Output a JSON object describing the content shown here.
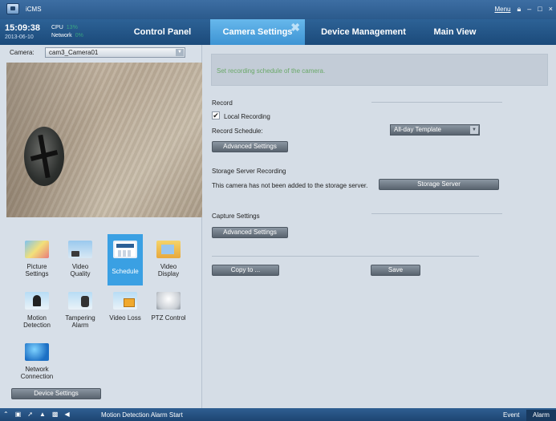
{
  "window": {
    "title": "iCMS",
    "menu_label": "Menu"
  },
  "header": {
    "time": "15:09:38",
    "date": "2013-06-10",
    "cpu_label": "CPU",
    "cpu_value": "13%",
    "network_label": "Network",
    "network_value": "0%"
  },
  "tabs": [
    {
      "label": "Control Panel"
    },
    {
      "label": "Camera Settings",
      "active": true
    },
    {
      "label": "Device Management"
    },
    {
      "label": "Main View"
    }
  ],
  "left": {
    "camera_label": "Camera:",
    "camera_value": "cam3_Camera01",
    "tiles": [
      {
        "label": "Picture Settings",
        "icon": "picture-settings-icon"
      },
      {
        "label": "Video Quality",
        "icon": "video-quality-icon"
      },
      {
        "label": "Schedule",
        "icon": "schedule-icon",
        "selected": true
      },
      {
        "label": "Video Display",
        "icon": "video-display-icon"
      },
      {
        "label": "Motion Detection",
        "icon": "motion-detection-icon"
      },
      {
        "label": "Tampering Alarm",
        "icon": "tampering-alarm-icon"
      },
      {
        "label": "Video Loss",
        "icon": "video-loss-icon"
      },
      {
        "label": "PTZ Control",
        "icon": "ptz-control-icon"
      },
      {
        "label": "Network Connection",
        "icon": "network-connection-icon"
      }
    ],
    "device_settings_label": "Device Settings"
  },
  "content": {
    "info": "Set recording schedule of the camera.",
    "record_title": "Record",
    "local_recording_label": "Local Recording",
    "local_recording_checked": true,
    "record_schedule_label": "Record Schedule:",
    "record_schedule_value": "All-day Template",
    "advanced_settings_label": "Advanced Settings",
    "storage_title": "Storage Server Recording",
    "storage_text": "This camera has not been added to the storage server.",
    "storage_button_label": "Storage Server",
    "capture_title": "Capture Settings",
    "capture_advanced_label": "Advanced Settings",
    "copy_to_label": "Copy to ...",
    "save_label": "Save"
  },
  "statusbar": {
    "alarm_text": "Motion Detection Alarm Start",
    "event_label": "Event",
    "alarm_label": "Alarm"
  },
  "colors": {
    "accent": "#3aa0e3",
    "titlebar": "#2b5a8c",
    "panel_bg": "#d5dde6",
    "info_text": "#6aa868"
  }
}
